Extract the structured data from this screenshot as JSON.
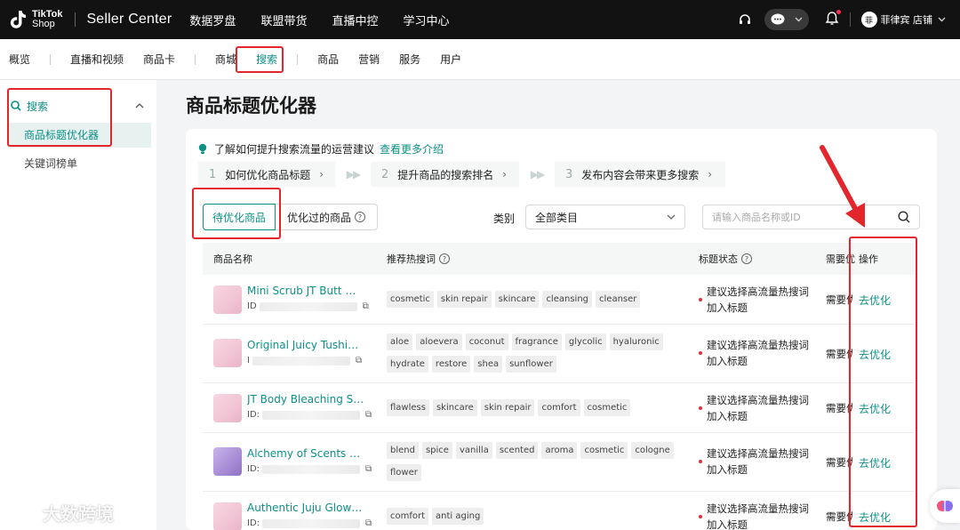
{
  "topbar": {
    "logo_line1": "TikTok",
    "logo_line2": "Shop",
    "brand": "Seller Center",
    "nav": [
      "数据罗盘",
      "联盟带货",
      "直播中控",
      "学习中心"
    ],
    "store_name": "菲律宾 店铺",
    "store_avatar": "菲"
  },
  "subnav": {
    "items": [
      "概览",
      "直播和视频",
      "商品卡",
      "商城",
      "搜索",
      "商品",
      "营销",
      "服务",
      "用户"
    ],
    "active": "搜索"
  },
  "sidebar": {
    "group_label": "搜索",
    "items": [
      "商品标题优化器",
      "关键词榜单"
    ]
  },
  "main": {
    "title": "商品标题优化器",
    "tip_text": "了解如何提升搜索流量的运营建议",
    "tip_link": "查看更多介绍",
    "steps": [
      {
        "num": "1",
        "label": "如何优化商品标题"
      },
      {
        "num": "2",
        "label": "提升商品的搜索排名"
      },
      {
        "num": "3",
        "label": "发布内容会带来更多搜索"
      }
    ],
    "tabs": [
      "待优化商品",
      "优化过的商品"
    ],
    "category_label": "类别",
    "category_value": "全部类目",
    "search_placeholder": "请输入商品名称或ID"
  },
  "table": {
    "headers": [
      "商品名称",
      "推荐热搜词",
      "标题状态",
      "需要优",
      "操作"
    ],
    "rows": [
      {
        "name": "Mini Scrub JT Butt Ma...",
        "id_prefix": "ID",
        "tags": [
          "cosmetic",
          "skin repair",
          "skincare",
          "cleansing",
          "cleanser"
        ],
        "status_line1": "建议选择高流量热搜词",
        "status_line2": "加入标题",
        "need": "需要优化",
        "action": "去优化"
      },
      {
        "name": "Original Juicy Tushie ...",
        "id_prefix": "I",
        "tags": [
          "aloe",
          "aloevera",
          "coconut",
          "fragrance",
          "glycolic",
          "hyaluronic",
          "hydrate",
          "restore",
          "shea",
          "sunflower"
        ],
        "status_line1": "建议选择高流量热搜词",
        "status_line2": "加入标题",
        "need": "需要优化",
        "action": "去优化"
      },
      {
        "name": "JT Body Bleaching Ser...",
        "id_prefix": "ID:",
        "tags": [
          "flawless",
          "skincare",
          "skin repair",
          "comfort",
          "cosmetic"
        ],
        "status_line1": "建议选择高流量热搜词",
        "status_line2": "加入标题",
        "need": "需要优化",
        "action": "去优化"
      },
      {
        "name": "Alchemy of Scents Per...",
        "id_prefix": "ID:",
        "tags": [
          "blend",
          "spice",
          "vanilla",
          "scented",
          "aroma",
          "cosmetic",
          "cologne",
          "flower"
        ],
        "status_line1": "建议选择高流量热搜词",
        "status_line2": "加入标题",
        "need": "需要优化",
        "action": "去优化"
      },
      {
        "name": "Authentic Juju Glow K...",
        "id_prefix": "ID:",
        "tags": [
          "comfort",
          "anti aging"
        ],
        "status_line1": "建议选择高流量热搜词",
        "status_line2": "加入标题",
        "need": "需要优化",
        "action": "去优化"
      }
    ]
  },
  "watermark": "大数跨境",
  "colors": {
    "accent": "#0d8f86",
    "annotation": "#e2262b",
    "topbar": "#121212"
  }
}
